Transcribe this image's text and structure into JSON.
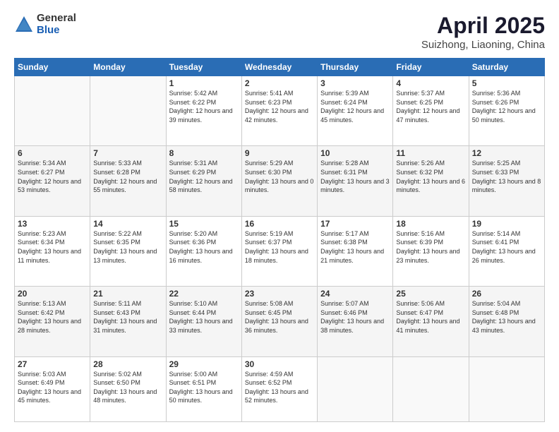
{
  "header": {
    "logo_general": "General",
    "logo_blue": "Blue",
    "title": "April 2025",
    "location": "Suizhong, Liaoning, China"
  },
  "calendar": {
    "days_of_week": [
      "Sunday",
      "Monday",
      "Tuesday",
      "Wednesday",
      "Thursday",
      "Friday",
      "Saturday"
    ],
    "weeks": [
      [
        {
          "day": "",
          "info": ""
        },
        {
          "day": "",
          "info": ""
        },
        {
          "day": "1",
          "info": "Sunrise: 5:42 AM\nSunset: 6:22 PM\nDaylight: 12 hours\nand 39 minutes."
        },
        {
          "day": "2",
          "info": "Sunrise: 5:41 AM\nSunset: 6:23 PM\nDaylight: 12 hours\nand 42 minutes."
        },
        {
          "day": "3",
          "info": "Sunrise: 5:39 AM\nSunset: 6:24 PM\nDaylight: 12 hours\nand 45 minutes."
        },
        {
          "day": "4",
          "info": "Sunrise: 5:37 AM\nSunset: 6:25 PM\nDaylight: 12 hours\nand 47 minutes."
        },
        {
          "day": "5",
          "info": "Sunrise: 5:36 AM\nSunset: 6:26 PM\nDaylight: 12 hours\nand 50 minutes."
        }
      ],
      [
        {
          "day": "6",
          "info": "Sunrise: 5:34 AM\nSunset: 6:27 PM\nDaylight: 12 hours\nand 53 minutes."
        },
        {
          "day": "7",
          "info": "Sunrise: 5:33 AM\nSunset: 6:28 PM\nDaylight: 12 hours\nand 55 minutes."
        },
        {
          "day": "8",
          "info": "Sunrise: 5:31 AM\nSunset: 6:29 PM\nDaylight: 12 hours\nand 58 minutes."
        },
        {
          "day": "9",
          "info": "Sunrise: 5:29 AM\nSunset: 6:30 PM\nDaylight: 13 hours\nand 0 minutes."
        },
        {
          "day": "10",
          "info": "Sunrise: 5:28 AM\nSunset: 6:31 PM\nDaylight: 13 hours\nand 3 minutes."
        },
        {
          "day": "11",
          "info": "Sunrise: 5:26 AM\nSunset: 6:32 PM\nDaylight: 13 hours\nand 6 minutes."
        },
        {
          "day": "12",
          "info": "Sunrise: 5:25 AM\nSunset: 6:33 PM\nDaylight: 13 hours\nand 8 minutes."
        }
      ],
      [
        {
          "day": "13",
          "info": "Sunrise: 5:23 AM\nSunset: 6:34 PM\nDaylight: 13 hours\nand 11 minutes."
        },
        {
          "day": "14",
          "info": "Sunrise: 5:22 AM\nSunset: 6:35 PM\nDaylight: 13 hours\nand 13 minutes."
        },
        {
          "day": "15",
          "info": "Sunrise: 5:20 AM\nSunset: 6:36 PM\nDaylight: 13 hours\nand 16 minutes."
        },
        {
          "day": "16",
          "info": "Sunrise: 5:19 AM\nSunset: 6:37 PM\nDaylight: 13 hours\nand 18 minutes."
        },
        {
          "day": "17",
          "info": "Sunrise: 5:17 AM\nSunset: 6:38 PM\nDaylight: 13 hours\nand 21 minutes."
        },
        {
          "day": "18",
          "info": "Sunrise: 5:16 AM\nSunset: 6:39 PM\nDaylight: 13 hours\nand 23 minutes."
        },
        {
          "day": "19",
          "info": "Sunrise: 5:14 AM\nSunset: 6:41 PM\nDaylight: 13 hours\nand 26 minutes."
        }
      ],
      [
        {
          "day": "20",
          "info": "Sunrise: 5:13 AM\nSunset: 6:42 PM\nDaylight: 13 hours\nand 28 minutes."
        },
        {
          "day": "21",
          "info": "Sunrise: 5:11 AM\nSunset: 6:43 PM\nDaylight: 13 hours\nand 31 minutes."
        },
        {
          "day": "22",
          "info": "Sunrise: 5:10 AM\nSunset: 6:44 PM\nDaylight: 13 hours\nand 33 minutes."
        },
        {
          "day": "23",
          "info": "Sunrise: 5:08 AM\nSunset: 6:45 PM\nDaylight: 13 hours\nand 36 minutes."
        },
        {
          "day": "24",
          "info": "Sunrise: 5:07 AM\nSunset: 6:46 PM\nDaylight: 13 hours\nand 38 minutes."
        },
        {
          "day": "25",
          "info": "Sunrise: 5:06 AM\nSunset: 6:47 PM\nDaylight: 13 hours\nand 41 minutes."
        },
        {
          "day": "26",
          "info": "Sunrise: 5:04 AM\nSunset: 6:48 PM\nDaylight: 13 hours\nand 43 minutes."
        }
      ],
      [
        {
          "day": "27",
          "info": "Sunrise: 5:03 AM\nSunset: 6:49 PM\nDaylight: 13 hours\nand 45 minutes."
        },
        {
          "day": "28",
          "info": "Sunrise: 5:02 AM\nSunset: 6:50 PM\nDaylight: 13 hours\nand 48 minutes."
        },
        {
          "day": "29",
          "info": "Sunrise: 5:00 AM\nSunset: 6:51 PM\nDaylight: 13 hours\nand 50 minutes."
        },
        {
          "day": "30",
          "info": "Sunrise: 4:59 AM\nSunset: 6:52 PM\nDaylight: 13 hours\nand 52 minutes."
        },
        {
          "day": "",
          "info": ""
        },
        {
          "day": "",
          "info": ""
        },
        {
          "day": "",
          "info": ""
        }
      ]
    ]
  }
}
